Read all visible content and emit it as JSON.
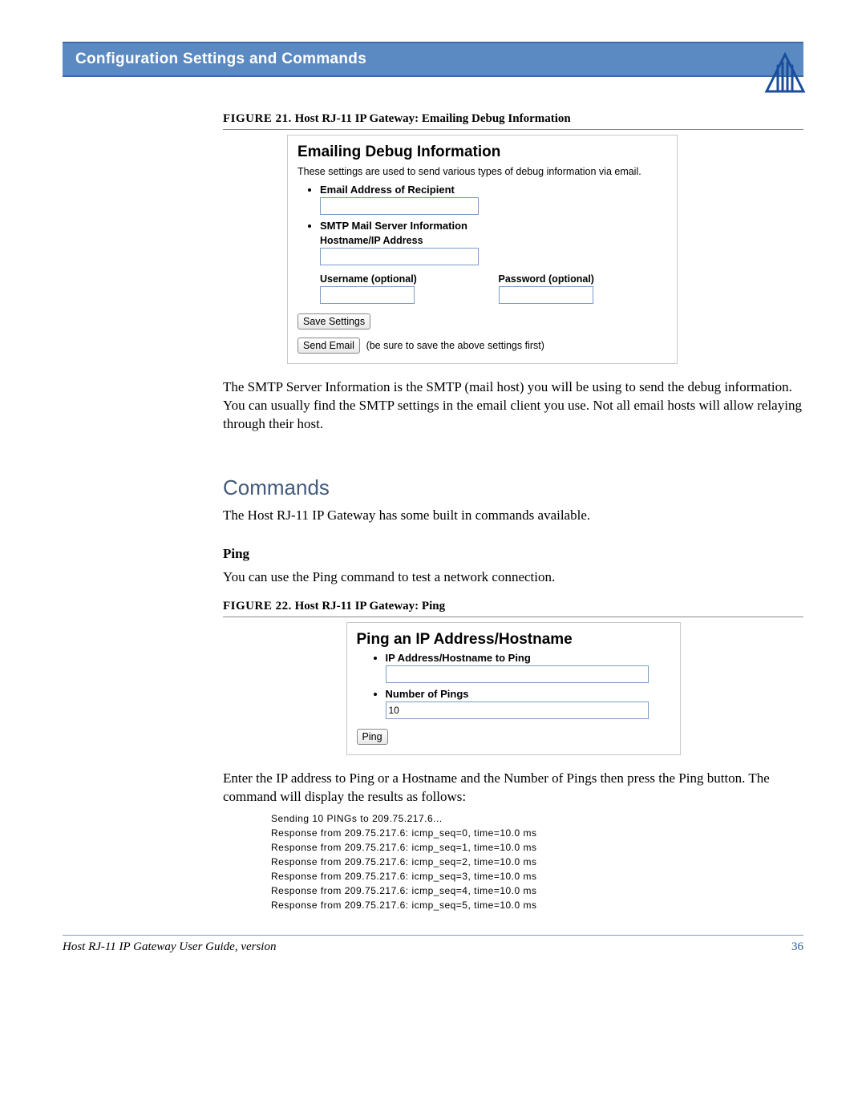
{
  "header": {
    "title": "Configuration Settings and Commands"
  },
  "figure21": {
    "caption_prefix": "FIGURE 21.",
    "caption": "Host RJ-11 IP Gateway: Emailing Debug Information",
    "panel_title": "Emailing Debug Information",
    "panel_desc": "These settings are used to send various types of debug information via email.",
    "field_email": "Email Address of Recipient",
    "field_smtp": "SMTP Mail Server Information",
    "field_hostname": "Hostname/IP Address",
    "field_username": "Username (optional)",
    "field_password": "Password (optional)",
    "btn_save": "Save Settings",
    "btn_send": "Send Email",
    "send_note": "(be sure to save the above settings first)"
  },
  "para_smtp": "The SMTP Server Information is the SMTP (mail host) you will be using to send the debug information. You can usually find the SMTP settings in the email client you use. Not all email hosts will allow relaying through their host.",
  "commands": {
    "heading": "Commands",
    "intro": "The Host RJ-11 IP Gateway has some built in commands available."
  },
  "ping": {
    "heading": "Ping",
    "intro": "You can use the Ping command to test a network connection."
  },
  "figure22": {
    "caption_prefix": "FIGURE 22.",
    "caption": "Host RJ-11 IP Gateway: Ping",
    "panel_title": "Ping an IP Address/Hostname",
    "field_ip": "IP Address/Hostname to Ping",
    "field_num": "Number of Pings",
    "num_value": "10",
    "btn_ping": "Ping"
  },
  "para_ping": "Enter the IP address to Ping or a Hostname and the Number of Pings then press the Ping button. The command will display the results as follows:",
  "ping_output": "Sending 10 PINGs to 209.75.217.6...\nResponse from 209.75.217.6: icmp_seq=0, time=10.0 ms\nResponse from 209.75.217.6: icmp_seq=1, time=10.0 ms\nResponse from 209.75.217.6: icmp_seq=2, time=10.0 ms\nResponse from 209.75.217.6: icmp_seq=3, time=10.0 ms\nResponse from 209.75.217.6: icmp_seq=4, time=10.0 ms\nResponse from 209.75.217.6: icmp_seq=5, time=10.0 ms",
  "footer": {
    "title": "Host RJ-11 IP Gateway User Guide, version",
    "page": "36"
  }
}
